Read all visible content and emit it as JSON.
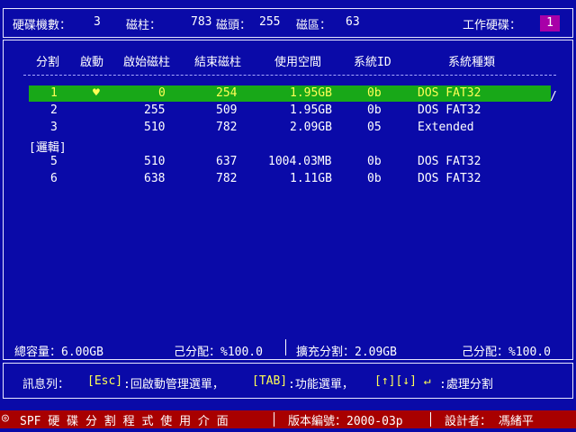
{
  "header": {
    "disks_label": "硬碟機數：",
    "disks_value": "3",
    "cyl_label": "磁柱：",
    "cyl_value": "783",
    "heads_label": "磁頭：",
    "heads_value": "255",
    "sectors_label": "磁區：",
    "sectors_value": "63",
    "work_disk_label": "工作硬碟：",
    "work_disk_value": "1"
  },
  "columns": [
    "分割",
    "啟動",
    "啟始磁柱",
    "結束磁柱",
    "使用空間",
    "系統ID",
    "系統種類"
  ],
  "partitions": [
    {
      "num": "1",
      "boot": "♥",
      "start": "0",
      "end": "254",
      "size": "1.95GB",
      "id": "0b",
      "type": "DOS FAT32",
      "selected": true
    },
    {
      "num": "2",
      "boot": "",
      "start": "255",
      "end": "509",
      "size": "1.95GB",
      "id": "0b",
      "type": "DOS FAT32"
    },
    {
      "num": "3",
      "boot": "",
      "start": "510",
      "end": "782",
      "size": "2.09GB",
      "id": "05",
      "type": "Extended"
    },
    {
      "num": "5",
      "boot": "",
      "start": "510",
      "end": "637",
      "size": "1004.03MB",
      "id": "0b",
      "type": "DOS FAT32"
    },
    {
      "num": "6",
      "boot": "",
      "start": "638",
      "end": "782",
      "size": "1.11GB",
      "id": "0b",
      "type": "DOS FAT32"
    }
  ],
  "logical_label": "[邏輯]",
  "cursor_mark": "/",
  "summary": {
    "total": "總容量：6.00GB",
    "allocated1": "己分配：%100.0",
    "extended": "擴充分割：2.09GB",
    "allocated2": "己分配：%100.0"
  },
  "message": {
    "label": "訊息列：",
    "esc_key": "[Esc]",
    "esc_text": ":回啟動管理選單，",
    "tab_key": "[TAB]",
    "tab_text": ":功能選單，",
    "arrow_key": "[↑][↓] ↵",
    "arrow_text": ":處理分割"
  },
  "status": {
    "icon": "◎",
    "title": "SPF 硬 碟 分 割 程 式 使 用 介 面",
    "version": "版本編號：2000-03p",
    "author": "設計者： 馮緒平"
  }
}
